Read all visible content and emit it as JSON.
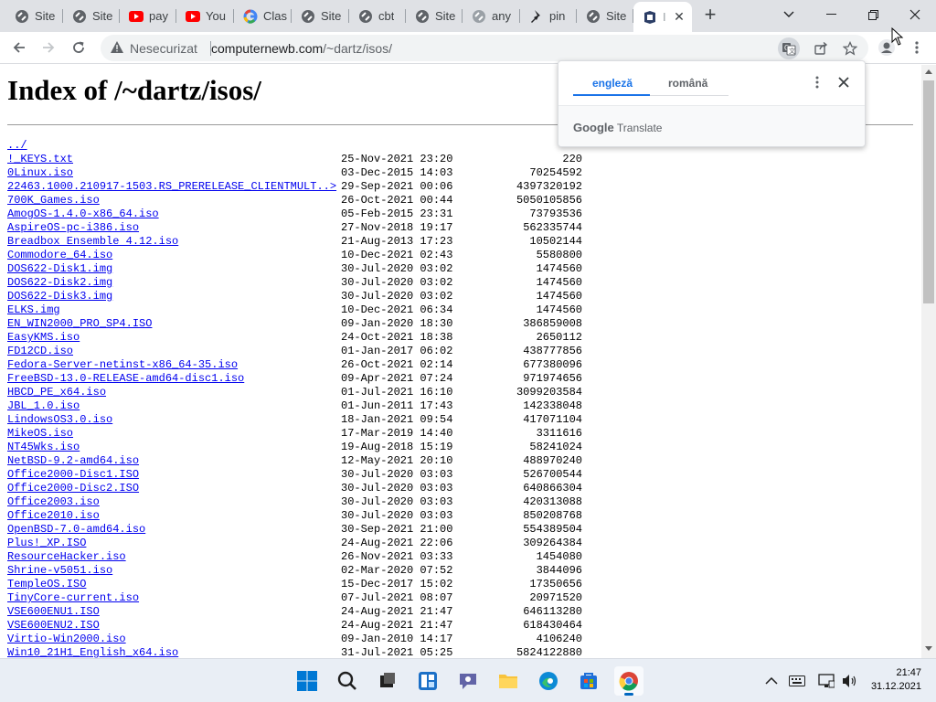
{
  "tabs": [
    {
      "label": "Site",
      "icon": "globe-icon"
    },
    {
      "label": "Site",
      "icon": "globe-icon"
    },
    {
      "label": "pay",
      "icon": "youtube-icon"
    },
    {
      "label": "You",
      "icon": "youtube-icon"
    },
    {
      "label": "Clas",
      "icon": "google-icon"
    },
    {
      "label": "Site",
      "icon": "globe-icon"
    },
    {
      "label": "cbt",
      "icon": "globe-icon"
    },
    {
      "label": "Site",
      "icon": "globe-icon"
    },
    {
      "label": "any",
      "icon": "globe-icon"
    },
    {
      "label": "pin",
      "icon": "pin-icon"
    },
    {
      "label": "Site",
      "icon": "globe-icon"
    },
    {
      "label": "I",
      "icon": "site-logo-icon",
      "active": true
    }
  ],
  "toolbar": {
    "security_label": "Nesecurizat",
    "url_host": "computernewb.com",
    "url_path": "/~dartz/isos/"
  },
  "page": {
    "title": "Index of /~dartz/isos/",
    "parent_link": "../",
    "files": [
      {
        "name": "!_KEYS.txt",
        "date": "25-Nov-2021 23:20",
        "size": "220"
      },
      {
        "name": "0Linux.iso",
        "date": "03-Dec-2015 14:03",
        "size": "70254592"
      },
      {
        "name": "22463.1000.210917-1503.RS_PRERELEASE_CLIENTMULT..>",
        "date": "29-Sep-2021 00:06",
        "size": "4397320192"
      },
      {
        "name": "700K_Games.iso",
        "date": "26-Oct-2021 00:44",
        "size": "5050105856"
      },
      {
        "name": "AmogOS-1.4.0-x86_64.iso",
        "date": "05-Feb-2015 23:31",
        "size": "73793536"
      },
      {
        "name": "AspireOS-pc-i386.iso",
        "date": "27-Nov-2018 19:17",
        "size": "562335744"
      },
      {
        "name": "Breadbox Ensemble 4.12.iso",
        "date": "21-Aug-2013 17:23",
        "size": "10502144"
      },
      {
        "name": "Commodore_64.iso",
        "date": "10-Dec-2021 02:43",
        "size": "5580800"
      },
      {
        "name": "DOS622-Disk1.img",
        "date": "30-Jul-2020 03:02",
        "size": "1474560"
      },
      {
        "name": "DOS622-Disk2.img",
        "date": "30-Jul-2020 03:02",
        "size": "1474560"
      },
      {
        "name": "DOS622-Disk3.img",
        "date": "30-Jul-2020 03:02",
        "size": "1474560"
      },
      {
        "name": "ELKS.img",
        "date": "10-Dec-2021 06:34",
        "size": "1474560"
      },
      {
        "name": "EN_WIN2000_PRO_SP4.ISO",
        "date": "09-Jan-2020 18:30",
        "size": "386859008"
      },
      {
        "name": "EasyKMS.iso",
        "date": "24-Oct-2021 18:38",
        "size": "2650112"
      },
      {
        "name": "FD12CD.iso",
        "date": "01-Jan-2017 06:02",
        "size": "438777856"
      },
      {
        "name": "Fedora-Server-netinst-x86_64-35.iso",
        "date": "26-Oct-2021 02:14",
        "size": "677380096"
      },
      {
        "name": "FreeBSD-13.0-RELEASE-amd64-disc1.iso",
        "date": "09-Apr-2021 07:24",
        "size": "971974656"
      },
      {
        "name": "HBCD_PE_x64.iso",
        "date": "01-Jul-2021 16:10",
        "size": "3099203584"
      },
      {
        "name": "JBL_1.0.iso",
        "date": "01-Jun-2011 17:43",
        "size": "142338048"
      },
      {
        "name": "LindowsOS3.0.iso",
        "date": "18-Jan-2021 09:54",
        "size": "417071104"
      },
      {
        "name": "MikeOS.iso",
        "date": "17-Mar-2019 14:40",
        "size": "3311616"
      },
      {
        "name": "NT45Wks.iso",
        "date": "19-Aug-2018 15:19",
        "size": "58241024"
      },
      {
        "name": "NetBSD-9.2-amd64.iso",
        "date": "12-May-2021 20:10",
        "size": "488970240"
      },
      {
        "name": "Office2000-Disc1.ISO",
        "date": "30-Jul-2020 03:03",
        "size": "526700544"
      },
      {
        "name": "Office2000-Disc2.ISO",
        "date": "30-Jul-2020 03:03",
        "size": "640866304"
      },
      {
        "name": "Office2003.iso",
        "date": "30-Jul-2020 03:03",
        "size": "420313088"
      },
      {
        "name": "Office2010.iso",
        "date": "30-Jul-2020 03:03",
        "size": "850208768"
      },
      {
        "name": "OpenBSD-7.0-amd64.iso",
        "date": "30-Sep-2021 21:00",
        "size": "554389504"
      },
      {
        "name": "Plus!_XP.ISO",
        "date": "24-Aug-2021 22:06",
        "size": "309264384"
      },
      {
        "name": "ResourceHacker.iso",
        "date": "26-Nov-2021 03:33",
        "size": "1454080"
      },
      {
        "name": "Shrine-v5051.iso",
        "date": "02-Mar-2020 07:52",
        "size": "3844096"
      },
      {
        "name": "TempleOS.ISO",
        "date": "15-Dec-2017 15:02",
        "size": "17350656"
      },
      {
        "name": "TinyCore-current.iso",
        "date": "07-Jul-2021 08:07",
        "size": "20971520"
      },
      {
        "name": "VSE600ENU1.ISO",
        "date": "24-Aug-2021 21:47",
        "size": "646113280"
      },
      {
        "name": "VSE600ENU2.ISO",
        "date": "24-Aug-2021 21:47",
        "size": "618430464"
      },
      {
        "name": "Virtio-Win2000.iso",
        "date": "09-Jan-2010 14:17",
        "size": "4106240"
      },
      {
        "name": "Win10_21H1_English_x64.iso",
        "date": "31-Jul-2021 05:25",
        "size": "5824122880"
      }
    ]
  },
  "translate": {
    "lang_source": "engleză",
    "lang_target": "română",
    "brand_google": "Google",
    "brand_translate": "Translate"
  },
  "taskbar": {
    "time": "21:47",
    "date": "31.12.2021",
    "apps": [
      "windows-start-icon",
      "search-icon",
      "task-view-icon",
      "widgets-icon",
      "teams-chat-icon",
      "file-explorer-icon",
      "edge-icon",
      "store-icon",
      "chrome-icon"
    ]
  },
  "colors": {
    "link": "#0000ee",
    "accent": "#1a73e8",
    "tabstrip": "#dfe1e5",
    "taskbar": "#e9eef5"
  }
}
